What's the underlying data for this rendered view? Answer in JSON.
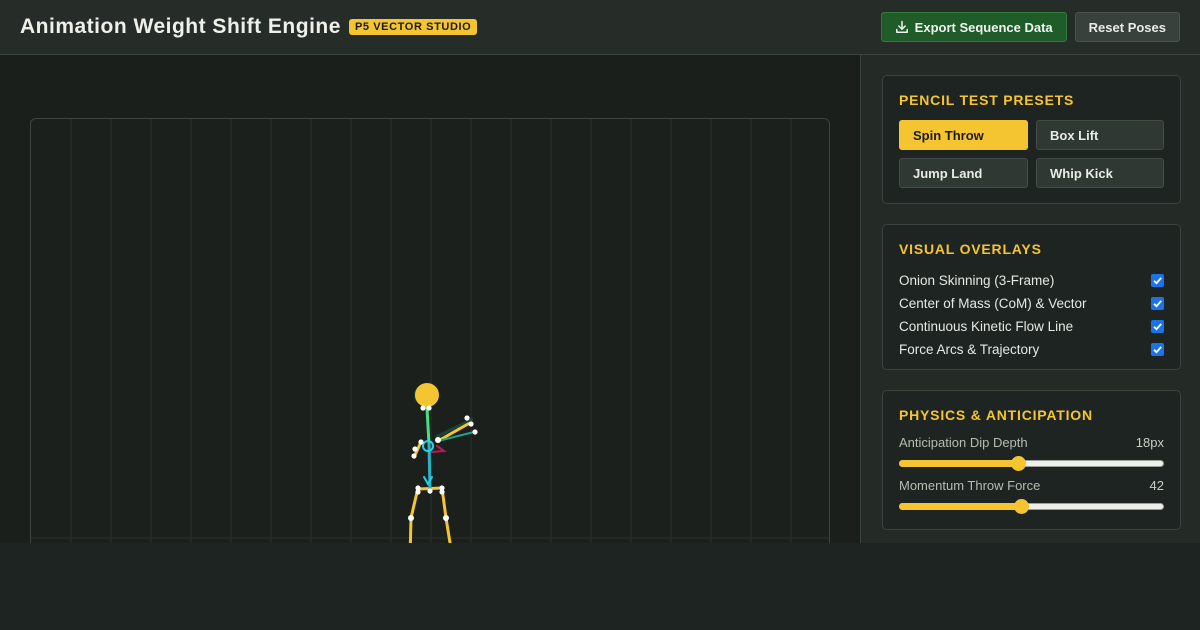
{
  "header": {
    "title": "Animation Weight Shift Engine",
    "badge": "P5 VECTOR STUDIO",
    "export_label": "Export Sequence Data",
    "reset_label": "Reset Poses"
  },
  "presets": {
    "title": "PENCIL TEST PRESETS",
    "items": [
      {
        "label": "Spin Throw",
        "active": true
      },
      {
        "label": "Box Lift",
        "active": false
      },
      {
        "label": "Jump Land",
        "active": false
      },
      {
        "label": "Whip Kick",
        "active": false
      }
    ]
  },
  "overlays": {
    "title": "VISUAL OVERLAYS",
    "items": [
      {
        "label": "Onion Skinning (3-Frame)",
        "checked": true
      },
      {
        "label": "Center of Mass (CoM) & Vector",
        "checked": true
      },
      {
        "label": "Continuous Kinetic Flow Line",
        "checked": true
      },
      {
        "label": "Force Arcs & Trajectory",
        "checked": true
      }
    ]
  },
  "physics": {
    "title": "PHYSICS & ANTICIPATION",
    "sliders": [
      {
        "label": "Anticipation Dip Depth",
        "value_text": "18px",
        "fraction": 0.45
      },
      {
        "label": "Momentum Throw Force",
        "value_text": "42",
        "fraction": 0.46
      }
    ]
  },
  "colors": {
    "accent": "#f5c531",
    "export_bg": "#1f5c2a",
    "checkbox": "#1a73e8",
    "com_marker": "#22d3ee",
    "flow_line": "#4ade80",
    "force_arc": "#be185d"
  }
}
